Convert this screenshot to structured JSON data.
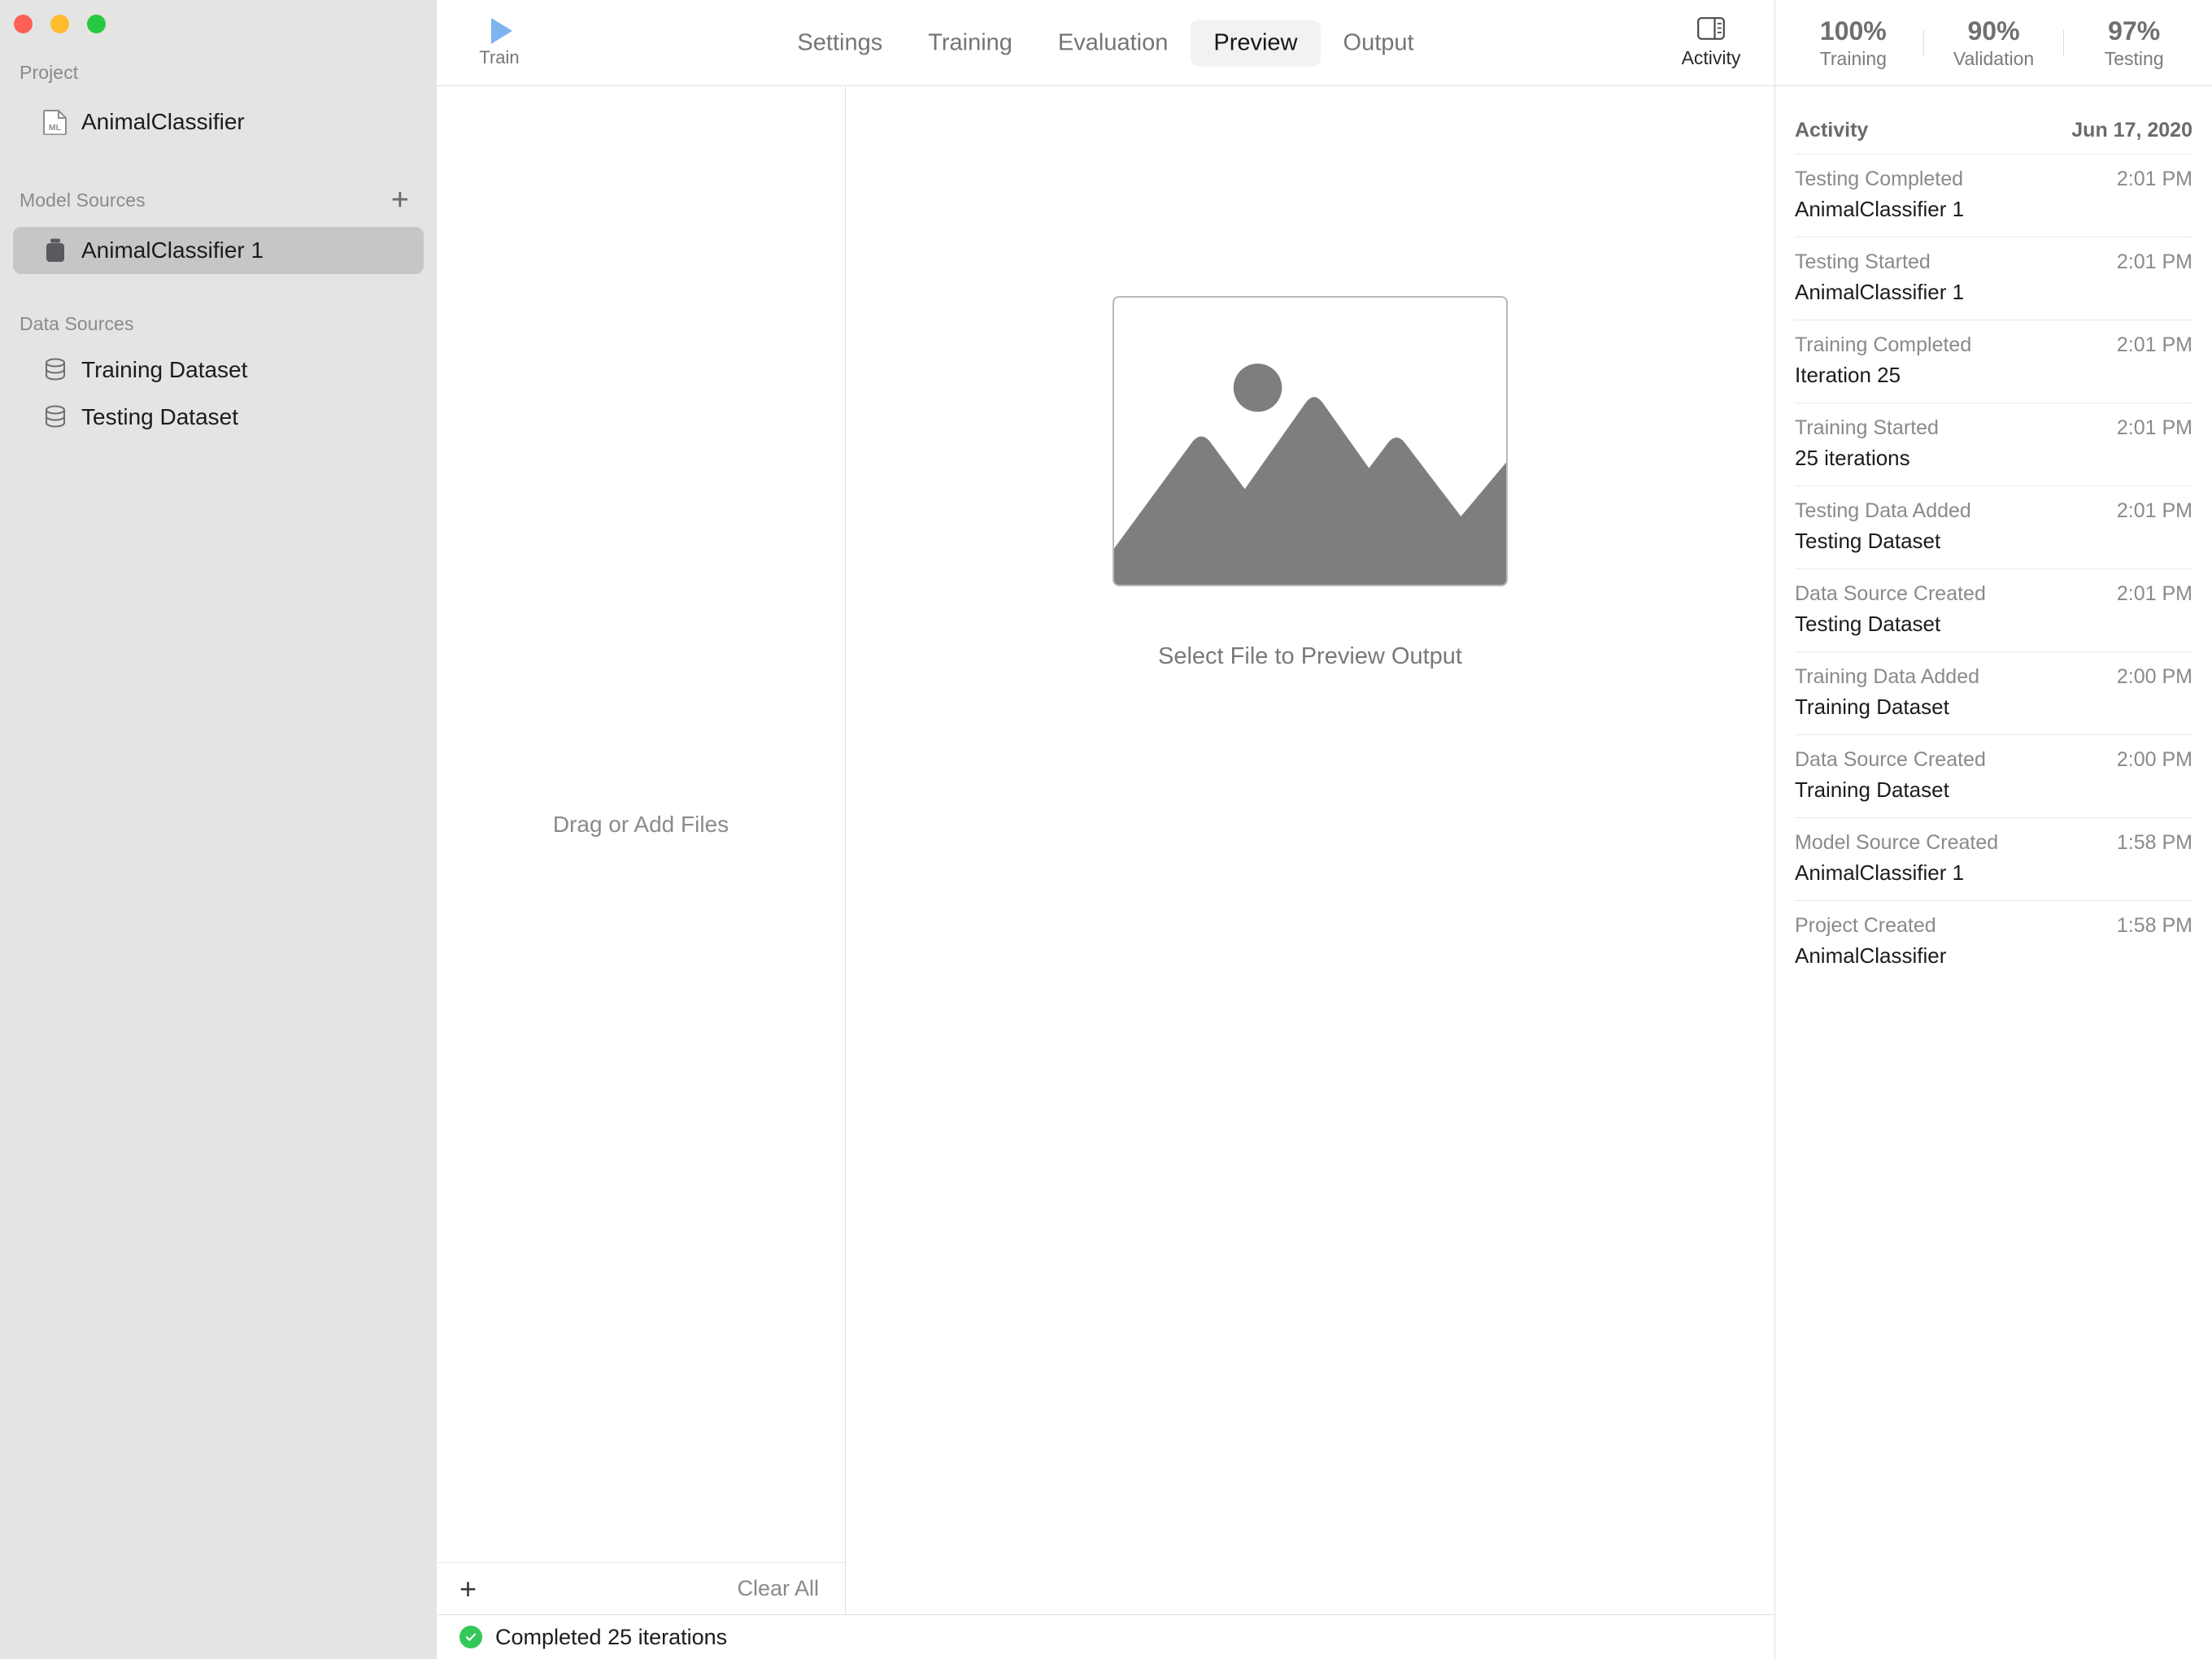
{
  "window": {
    "traffic_lights": [
      {
        "name": "close",
        "color": "#ff5f57"
      },
      {
        "name": "minimize",
        "color": "#febc2e"
      },
      {
        "name": "maximize",
        "color": "#28c840"
      }
    ]
  },
  "sidebar": {
    "sections": [
      {
        "label": "Project",
        "has_add": false,
        "items": [
          {
            "label": "AnimalClassifier",
            "icon": "ml-document-icon",
            "selected": false
          }
        ]
      },
      {
        "label": "Model Sources",
        "has_add": true,
        "add_label": "+",
        "items": [
          {
            "label": "AnimalClassifier 1",
            "icon": "model-source-icon",
            "selected": true
          }
        ]
      },
      {
        "label": "Data Sources",
        "has_add": false,
        "items": [
          {
            "label": "Training Dataset",
            "icon": "database-icon",
            "selected": false
          },
          {
            "label": "Testing Dataset",
            "icon": "database-icon",
            "selected": false
          }
        ]
      }
    ]
  },
  "toolbar": {
    "train": {
      "label": "Train",
      "icon": "play-icon"
    },
    "tabs": [
      {
        "label": "Settings",
        "active": false
      },
      {
        "label": "Training",
        "active": false
      },
      {
        "label": "Evaluation",
        "active": false
      },
      {
        "label": "Preview",
        "active": true
      },
      {
        "label": "Output",
        "active": false
      }
    ],
    "activity": {
      "label": "Activity",
      "icon": "sidebar-panel-icon"
    }
  },
  "files_pane": {
    "drop_hint": "Drag or Add Files",
    "add_label": "+",
    "clear_all_label": "Clear All"
  },
  "preview_pane": {
    "placeholder_icon": "image-placeholder-icon",
    "caption": "Select File to Preview Output"
  },
  "statusbar": {
    "icon": "success-check-icon",
    "text": "Completed 25 iterations"
  },
  "metrics": [
    {
      "value": "100%",
      "label": "Training"
    },
    {
      "value": "90%",
      "label": "Validation"
    },
    {
      "value": "97%",
      "label": "Testing"
    }
  ],
  "activity": {
    "title": "Activity",
    "date": "Jun 17, 2020",
    "items": [
      {
        "event": "Testing Completed",
        "time": "2:01 PM",
        "subject": "AnimalClassifier 1"
      },
      {
        "event": "Testing Started",
        "time": "2:01 PM",
        "subject": "AnimalClassifier 1"
      },
      {
        "event": "Training Completed",
        "time": "2:01 PM",
        "subject": "Iteration 25"
      },
      {
        "event": "Training Started",
        "time": "2:01 PM",
        "subject": "25 iterations"
      },
      {
        "event": "Testing Data Added",
        "time": "2:01 PM",
        "subject": "Testing Dataset"
      },
      {
        "event": "Data Source Created",
        "time": "2:01 PM",
        "subject": "Testing Dataset"
      },
      {
        "event": "Training Data Added",
        "time": "2:00 PM",
        "subject": "Training Dataset"
      },
      {
        "event": "Data Source Created",
        "time": "2:00 PM",
        "subject": "Training Dataset"
      },
      {
        "event": "Model Source Created",
        "time": "1:58 PM",
        "subject": "AnimalClassifier 1"
      },
      {
        "event": "Project Created",
        "time": "1:58 PM",
        "subject": "AnimalClassifier"
      }
    ]
  },
  "colors": {
    "accent_play": "#7db4f0",
    "success": "#34c759",
    "sidebar_bg": "#e4e4e4",
    "selection": "#c6c6c6"
  }
}
